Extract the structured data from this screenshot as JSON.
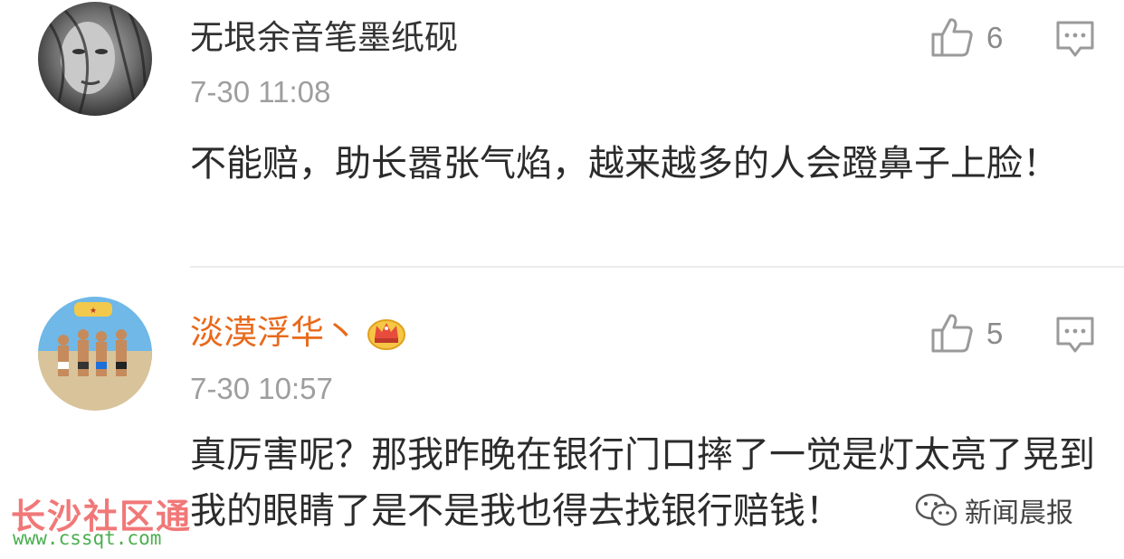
{
  "comments": [
    {
      "username": "无垠余音笔墨纸砚",
      "timestamp": "7-30 11:08",
      "likes": "6",
      "text": "不能赔，助长嚣张气焰，越来越多的人会蹬鼻子上脸！",
      "username_color": "#333333"
    },
    {
      "username": "淡漠浮华丶",
      "timestamp": "7-30 10:57",
      "likes": "5",
      "text": "真厉害呢？那我昨晚在银行门口摔了一觉是灯太亮了晃到我的眼睛了是不是我也得去找银行赔钱！",
      "username_color": "#e86a1c",
      "badge_icon": "crown-badge-icon"
    }
  ],
  "icons": {
    "like": "thumbs-up-icon",
    "reply": "comment-icon"
  },
  "watermarks": {
    "left_title": "长沙社区通",
    "left_url": "www.cssqt.com",
    "right_label": "新闻晨报",
    "right_icon": "wechat-icon"
  }
}
